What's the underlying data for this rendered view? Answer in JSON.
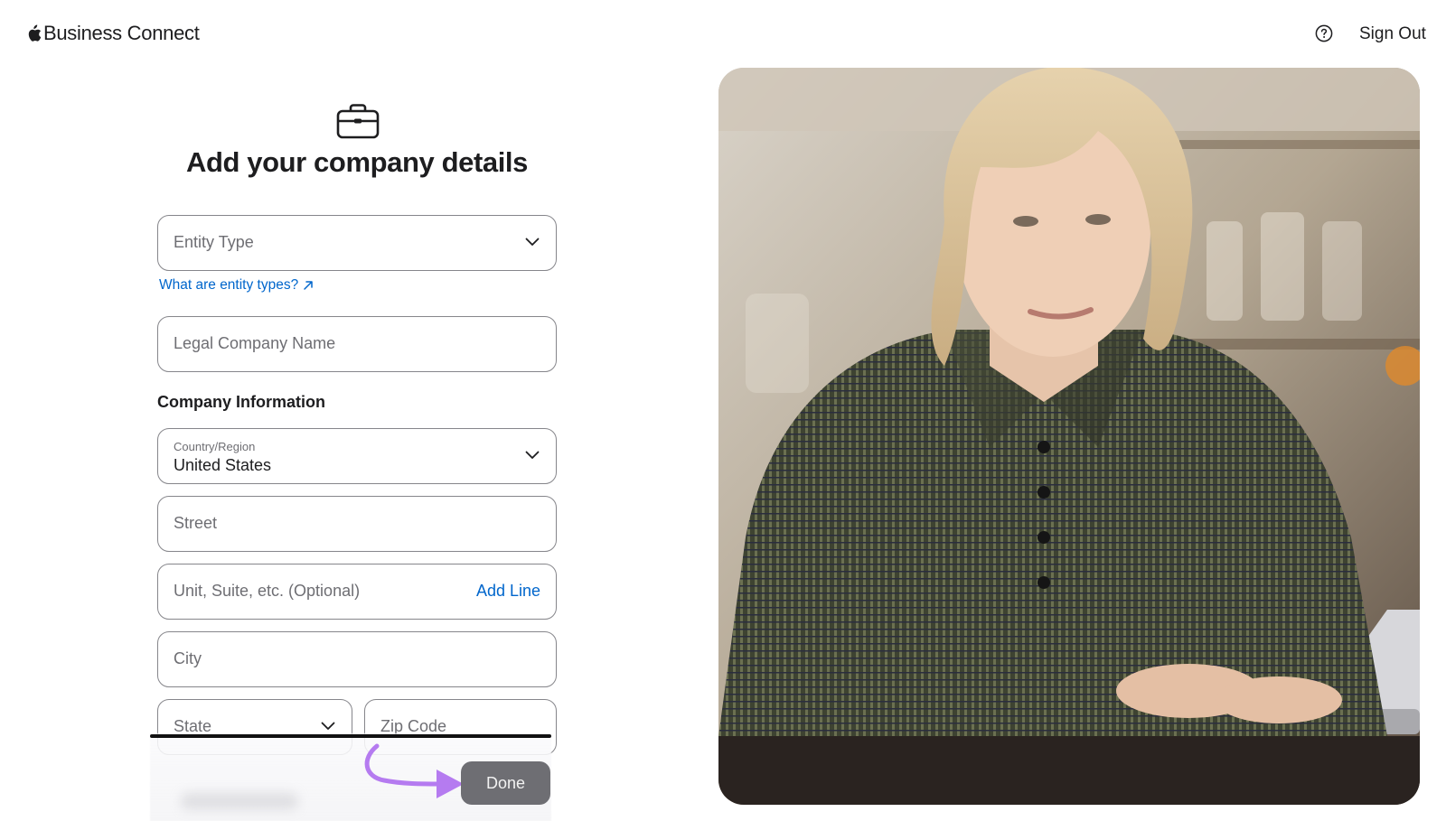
{
  "header": {
    "brand": "Business Connect",
    "help_icon": "question-circle-icon",
    "sign_out": "Sign Out"
  },
  "form": {
    "icon": "briefcase-icon",
    "title": "Add your company details",
    "entity_type": {
      "placeholder": "Entity Type"
    },
    "entity_link": "What are entity types?",
    "legal_name": {
      "placeholder": "Legal Company Name"
    },
    "section_heading": "Company Information",
    "country": {
      "label": "Country/Region",
      "value": "United States"
    },
    "street": {
      "placeholder": "Street"
    },
    "unit": {
      "placeholder": "Unit, Suite, etc. (Optional)",
      "add_line": "Add Line"
    },
    "city": {
      "placeholder": "City"
    },
    "state": {
      "placeholder": "State"
    },
    "zip": {
      "placeholder": "Zip Code"
    }
  },
  "footer": {
    "done": "Done"
  },
  "colors": {
    "link": "#0066cc",
    "done_bg": "#6e6e73",
    "arrow": "#b57bf0"
  }
}
